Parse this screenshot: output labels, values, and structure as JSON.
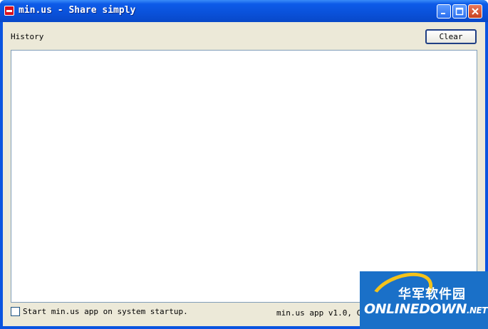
{
  "window": {
    "title": "min.us - Share simply"
  },
  "history": {
    "label": "History",
    "clear_label": "Clear",
    "items": []
  },
  "footer": {
    "startup_label": "Start min.us app on system startup.",
    "startup_checked": false,
    "version_text": "min.us app v1.0, Cop"
  },
  "watermark": {
    "chinese_text": "华军软件园",
    "english_text": "ONLINEDOWN",
    "suffix": ".NET"
  },
  "icons": {
    "app": "app-icon",
    "minimize": "minimize-icon",
    "maximize": "maximize-icon",
    "close": "close-icon"
  },
  "colors": {
    "titlebar": "#0a51da",
    "client_bg": "#ece9d8",
    "close_button": "#c7411f",
    "watermark_bg": "#1a70c8",
    "watermark_accent": "#f4c21a"
  }
}
